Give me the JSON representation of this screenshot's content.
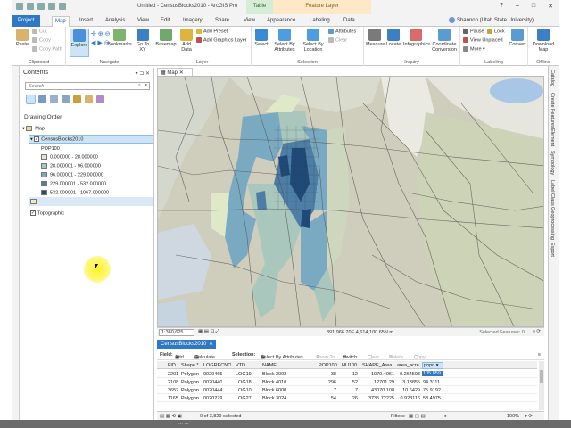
{
  "window": {
    "title": "Untitled - CensusBlocks2010 - ArcGIS Pro",
    "context_table": "Table",
    "context_feature_layer": "Feature Layer",
    "controls": [
      "?",
      "–",
      "□",
      "✕"
    ]
  },
  "tabs": {
    "items": [
      "Project",
      "Map",
      "Insert",
      "Analysis",
      "View",
      "Edit",
      "Imagery",
      "Share",
      "View",
      "Appearance",
      "Labeling",
      "Data"
    ],
    "active": "Map",
    "user": "Shannon (Utah State University)"
  },
  "ribbon": {
    "clipboard": {
      "label": "Clipboard",
      "paste": "Paste",
      "cut": "Cut",
      "copy": "Copy",
      "copy_path": "Copy Path"
    },
    "navigate": {
      "label": "Navigate",
      "explore": "Explore",
      "bookmarks": "Bookmarks",
      "goto": "Go To XY"
    },
    "layer": {
      "label": "Layer",
      "basemap": "Basemap",
      "add_data": "Add Data",
      "add_preset": "Add Preset",
      "add_graphics": "Add Graphics Layer"
    },
    "selection": {
      "label": "Selection",
      "select": "Select",
      "by_attributes": "Select By Attributes",
      "by_location": "Select By Location",
      "attributes": "Attributes",
      "clear": "Clear"
    },
    "inquiry": {
      "label": "Inquiry",
      "measure": "Measure",
      "locate": "Locate",
      "infographics": "Infographics",
      "coord_conv": "Coordinate Conversion"
    },
    "labeling": {
      "label": "Labeling",
      "pause": "Pause",
      "lock": "Lock",
      "view_unplaced": "View Unplaced",
      "more": "More",
      "convert": "Convert"
    },
    "offline": {
      "label": "Offline",
      "download": "Download Map"
    }
  },
  "right_strip": [
    "Catalog",
    "Create Features",
    "Element",
    "Symbology",
    "Label Class",
    "Geoprocessing",
    "Export"
  ],
  "contents": {
    "title": "Contents",
    "search_placeholder": "Search",
    "drawing_order": "Drawing Order",
    "map_node": "Map",
    "layer_name": "CensusBlocks2010",
    "field_name": "POP100",
    "classes": [
      {
        "label": "0.000000 - 28.000000",
        "color": "#dfe9c7"
      },
      {
        "label": "28.000001 - 96.000000",
        "color": "#a9c7bd"
      },
      {
        "label": "96.000001 - 229.000000",
        "color": "#7aaac2"
      },
      {
        "label": "229.000001 - 532.000000",
        "color": "#4d7ea6"
      },
      {
        "label": "532.000001 - 1067.000000",
        "color": "#1f4a78"
      }
    ],
    "extra_class_color": "#e9f0c8",
    "topographic": "Topographic"
  },
  "map": {
    "tab": "Map",
    "scale": "1:360,625",
    "coordinates": "391,966.70E 4,614,100.65N m",
    "selected_features": "Selected Features: 0"
  },
  "table": {
    "tab": "CensusBlocks2010",
    "toolbar": {
      "field": "Field:",
      "add": "Add",
      "calculate": "Calculate",
      "selection": "Selection:",
      "by_attributes": "Select By Attributes",
      "zoom_to": "Zoom To",
      "switch": "Switch",
      "clear": "Clear",
      "delete": "Delete",
      "copy": "Copy"
    },
    "columns": [
      "FID",
      "Shape *",
      "LOGRECNO",
      "VTD",
      "NAME",
      "POP100",
      "HU100",
      "SHAPE_Area",
      "area_acre",
      "popd"
    ],
    "rows": [
      [
        "2201",
        "Polygon",
        "0020465",
        "LOG19",
        "Block 3002",
        "38",
        "12",
        "1070.4061",
        "0.264503",
        "105.859"
      ],
      [
        "2108",
        "Polygon",
        "0020440",
        "LOG18",
        "Block 4010",
        "296",
        "52",
        "12701.29",
        "3.13855",
        "94.3111"
      ],
      [
        "3652",
        "Polygon",
        "0020444",
        "LOG10",
        "Block 6000",
        "7",
        "7",
        "43070.108",
        "10.6429",
        "75.9192"
      ],
      [
        "1165",
        "Polygon",
        "0020279",
        "LOG27",
        "Block 3024",
        "54",
        "26",
        "3735.72225",
        "0.923116",
        "58.4975"
      ]
    ],
    "status": {
      "selected": "0 of 3,829 selected",
      "filters": "Filters:",
      "zoom": "100%"
    }
  },
  "taskbar_text": "... ..."
}
